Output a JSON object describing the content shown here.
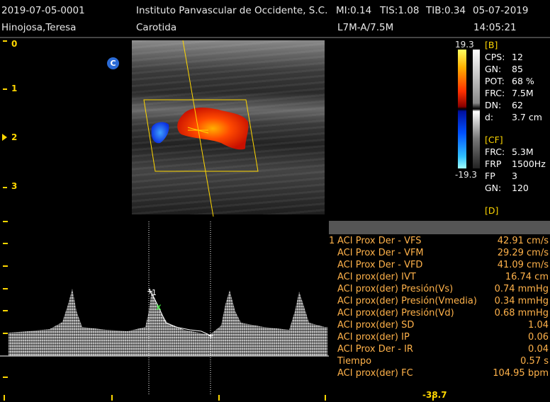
{
  "header": {
    "study_id": "2019-07-05-0001",
    "institution": "Instituto Panvascular de Occidente, S.C.",
    "mi": "MI:0.14",
    "tis": "TIS:1.08",
    "tib": "TIB:0.34",
    "date": "05-07-2019",
    "patient": "Hinojosa,Teresa",
    "exam": "Carotida",
    "probe": "L7M-A/7.5M",
    "time": "14:05:21"
  },
  "depth_scale": [
    "0",
    "1",
    "2",
    "3"
  ],
  "mode_badge": "C",
  "colorbar": {
    "top": "19.3",
    "bottom": "-19.3"
  },
  "b_mode": {
    "title": "[B]",
    "params": [
      {
        "k": "CPS:",
        "v": "12"
      },
      {
        "k": "GN:",
        "v": "85"
      },
      {
        "k": "POT:",
        "v": "68 %"
      },
      {
        "k": "FRC:",
        "v": "7.5M"
      },
      {
        "k": "DN:",
        "v": "62"
      },
      {
        "k": "d:",
        "v": "3.7 cm"
      }
    ]
  },
  "cf_mode": {
    "title": "[CF]",
    "params": [
      {
        "k": "FRC:",
        "v": "5.3M"
      },
      {
        "k": "FRP",
        "v": "1500Hz"
      },
      {
        "k": "FP",
        "v": "3"
      },
      {
        "k": "GN:",
        "v": "120"
      }
    ]
  },
  "d_mode": {
    "title": "[D]"
  },
  "measurements": [
    {
      "num": "1",
      "label": "ACI Prox Der - VFS",
      "value": "42.91 cm/s"
    },
    {
      "num": "",
      "label": "ACI Prox Der - VFM",
      "value": "29.29 cm/s"
    },
    {
      "num": "",
      "label": "ACI Prox Der - VFD",
      "value": "41.09 cm/s"
    },
    {
      "num": "",
      "label": "ACI prox(der) IVT",
      "value": "16.74 cm"
    },
    {
      "num": "",
      "label": "ACI prox(der) Presión(Vs)",
      "value": "0.74 mmHg"
    },
    {
      "num": "",
      "label": "ACI prox(der) Presión(Vmedia)",
      "value": "0.34 mmHg"
    },
    {
      "num": "",
      "label": "ACI prox(der) Presión(Vd)",
      "value": "0.68 mmHg"
    },
    {
      "num": "",
      "label": "ACI prox(der) SD",
      "value": "1.04"
    },
    {
      "num": "",
      "label": "ACI prox(der) IP",
      "value": "0.06"
    },
    {
      "num": "",
      "label": "ACI Prox Der - IR",
      "value": "0.04"
    },
    {
      "num": "",
      "label": "Tiempo",
      "value": "0.57 s"
    },
    {
      "num": "",
      "label": "ACI prox(der) FC",
      "value": "104.95 bpm"
    }
  ],
  "spectrum": {
    "marker_label": "1",
    "velocity_readout": "-38.7"
  },
  "colors": {
    "accent": "#ffd700",
    "measure_text": "#ffb24a",
    "flow_red": "#ff3a00",
    "flow_blue": "#1a5cff"
  }
}
